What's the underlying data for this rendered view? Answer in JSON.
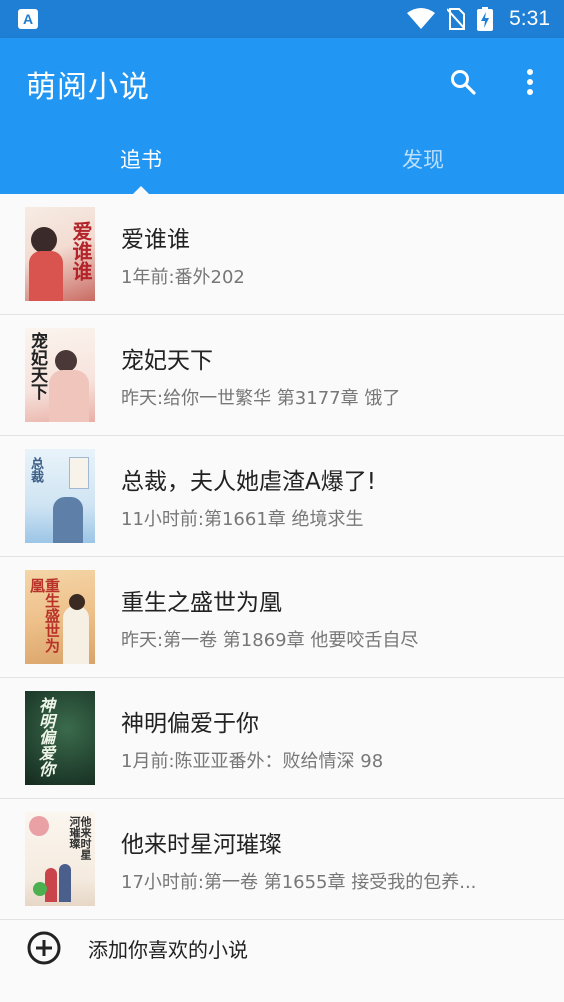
{
  "status_bar": {
    "time": "5:31",
    "notification_icon_letter": "A"
  },
  "app": {
    "title": "萌阅小说"
  },
  "tabs": [
    {
      "label": "追书",
      "active": true
    },
    {
      "label": "发现",
      "active": false
    }
  ],
  "books": [
    {
      "title": "爱谁谁",
      "update": "1年前:番外202",
      "cover_text": "爱谁谁"
    },
    {
      "title": "宠妃天下",
      "update": "昨天:给你一世繁华 第3177章  饿了",
      "cover_text": "宠妃天下"
    },
    {
      "title": "总裁，夫人她虐渣A爆了!",
      "update": "11小时前:第1661章 绝境求生",
      "cover_text": "总裁"
    },
    {
      "title": "重生之盛世为凰",
      "update": "昨天:第一卷 第1869章  他要咬舌自尽",
      "cover_text": "重生盛世为凰"
    },
    {
      "title": "神明偏爱于你",
      "update": "1月前:陈亚亚番外：败给情深 98",
      "cover_text": "神明偏爱你"
    },
    {
      "title": "他来时星河璀璨",
      "update": "17小时前:第一卷 第1655章  接受我的包养...",
      "cover_text": "他来时星河璀璨"
    }
  ],
  "add_action": {
    "label": "添加你喜欢的小说"
  },
  "colors": {
    "primary": "#2196f3",
    "status_bar": "#1e7fd4",
    "background": "#fafafa"
  }
}
